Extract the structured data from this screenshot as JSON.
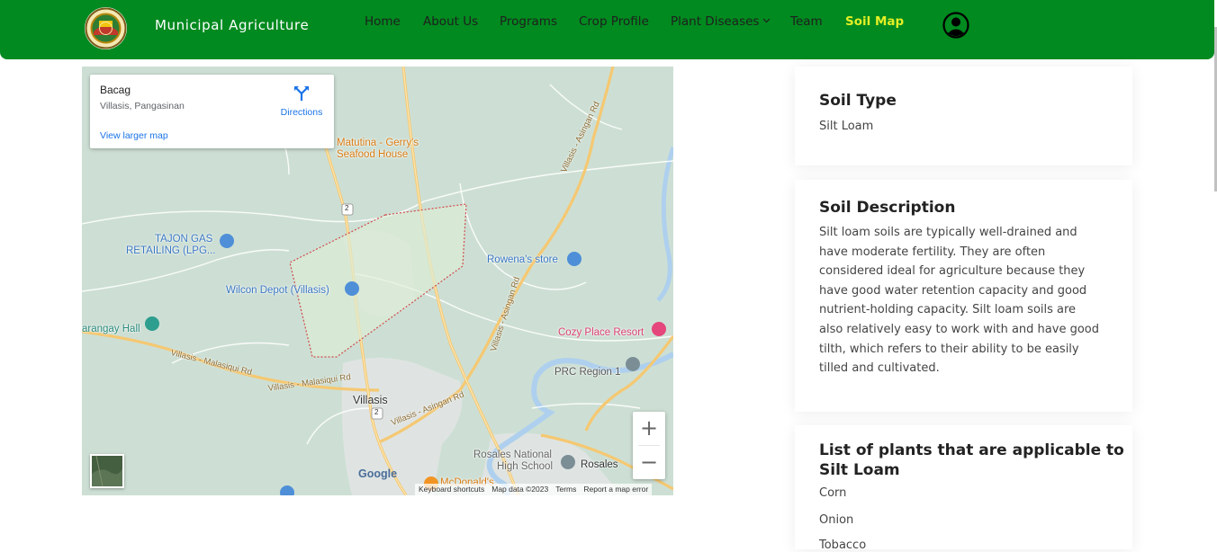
{
  "nav": {
    "brand": "Municipal Agriculture",
    "items": [
      {
        "label": "Home"
      },
      {
        "label": "About Us"
      },
      {
        "label": "Programs"
      },
      {
        "label": "Crop Profile"
      },
      {
        "label": "Plant Diseases"
      },
      {
        "label": "Team"
      },
      {
        "label": "Soil Map"
      }
    ],
    "active": "Soil Map",
    "colors": {
      "bar": "#008a1f",
      "active": "#e4ef25"
    }
  },
  "map": {
    "info": {
      "title": "Bacag",
      "subtitle": "Villasis, Pangasinan",
      "larger_link": "View larger map",
      "directions": "Directions"
    },
    "labels": {
      "matutina_1": "Matutina - Gerry's",
      "matutina_2": "Seafood House",
      "tajon_1": "TAJON GAS",
      "tajon_2": "RETAILING (LPG...",
      "wilcon": "Wilcon Depot (Villasis)",
      "rowena": "Rowena's store",
      "barangay": "arangay Hall",
      "cozy": "Cozy Place Resort",
      "prc": "PRC Region 1",
      "villasis": "Villasis",
      "rosales_nhs_1": "Rosales National",
      "rosales_nhs_2": "High School",
      "rosales": "Rosales",
      "mcdo": "McDonald's",
      "road_asingan_1": "Villasis - Asingan Rd",
      "road_asingan_2": "Villasis - Asingan Rd",
      "road_asingan_3": "Villasis - Asingan Rd",
      "road_malasiqui_1": "Villasis - Malasiqui Rd",
      "road_malasiqui_2": "Villasis - Malasiqui Rd",
      "route_2": "2"
    },
    "zoom_in": "+",
    "zoom_out": "−",
    "google": "Google",
    "attribution": [
      "Keyboard shortcuts",
      "Map data ©2023",
      "Terms",
      "Report a map error"
    ]
  },
  "soil_type": {
    "heading": "Soil Type",
    "value": "Silt Loam"
  },
  "soil_description": {
    "heading": "Soil Description",
    "lines": [
      "Silt loam soils are typically well-drained and",
      "have moderate fertility. They are often",
      "considered ideal for agriculture because they",
      "have good water retention capacity and good",
      "nutrient-holding capacity. Silt loam soils are",
      "also relatively easy to work with and have good",
      "tilth, which refers to their ability to be easily",
      "tilled and cultivated."
    ]
  },
  "plants": {
    "heading_1": "List of plants that are applicable to",
    "heading_2": "Silt Loam",
    "items": [
      "Corn",
      "Onion",
      "Tobacco"
    ]
  }
}
